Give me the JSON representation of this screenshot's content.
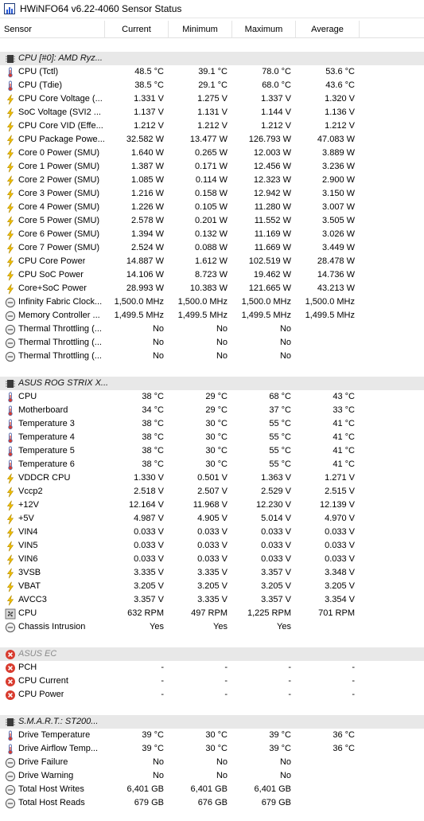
{
  "window": {
    "title": "HWiNFO64 v6.22-4060 Sensor Status"
  },
  "columns": [
    "Sensor",
    "Current",
    "Minimum",
    "Maximum",
    "Average"
  ],
  "colors": {
    "group_bg": "#e8e8e8",
    "accent_bolt": "#f5c400",
    "error_red": "#d83b2e"
  },
  "rows": [
    {
      "kind": "blank"
    },
    {
      "kind": "group",
      "icon": "chip-icon",
      "label": "CPU [#0]: AMD Ryz..."
    },
    {
      "kind": "sensor",
      "icon": "thermometer-icon",
      "label": "CPU (Tctl)",
      "cur": "48.5 °C",
      "min": "39.1 °C",
      "max": "78.0 °C",
      "avg": "53.6 °C"
    },
    {
      "kind": "sensor",
      "icon": "thermometer-icon",
      "label": "CPU (Tdie)",
      "cur": "38.5 °C",
      "min": "29.1 °C",
      "max": "68.0 °C",
      "avg": "43.6 °C"
    },
    {
      "kind": "sensor",
      "icon": "bolt-icon",
      "label": "CPU Core Voltage (...",
      "cur": "1.331 V",
      "min": "1.275 V",
      "max": "1.337 V",
      "avg": "1.320 V"
    },
    {
      "kind": "sensor",
      "icon": "bolt-icon",
      "label": "SoC Voltage (SVI2 ...",
      "cur": "1.137 V",
      "min": "1.131 V",
      "max": "1.144 V",
      "avg": "1.136 V"
    },
    {
      "kind": "sensor",
      "icon": "bolt-icon",
      "label": "CPU Core VID (Effe...",
      "cur": "1.212 V",
      "min": "1.212 V",
      "max": "1.212 V",
      "avg": "1.212 V"
    },
    {
      "kind": "sensor",
      "icon": "bolt-icon",
      "label": "CPU Package Powe...",
      "cur": "32.582 W",
      "min": "13.477 W",
      "max": "126.793 W",
      "avg": "47.083 W"
    },
    {
      "kind": "sensor",
      "icon": "bolt-icon",
      "label": "Core 0 Power (SMU)",
      "cur": "1.640 W",
      "min": "0.265 W",
      "max": "12.003 W",
      "avg": "3.889 W"
    },
    {
      "kind": "sensor",
      "icon": "bolt-icon",
      "label": "Core 1 Power (SMU)",
      "cur": "1.387 W",
      "min": "0.171 W",
      "max": "12.456 W",
      "avg": "3.236 W"
    },
    {
      "kind": "sensor",
      "icon": "bolt-icon",
      "label": "Core 2 Power (SMU)",
      "cur": "1.085 W",
      "min": "0.114 W",
      "max": "12.323 W",
      "avg": "2.900 W"
    },
    {
      "kind": "sensor",
      "icon": "bolt-icon",
      "label": "Core 3 Power (SMU)",
      "cur": "1.216 W",
      "min": "0.158 W",
      "max": "12.942 W",
      "avg": "3.150 W"
    },
    {
      "kind": "sensor",
      "icon": "bolt-icon",
      "label": "Core 4 Power (SMU)",
      "cur": "1.226 W",
      "min": "0.105 W",
      "max": "11.280 W",
      "avg": "3.007 W"
    },
    {
      "kind": "sensor",
      "icon": "bolt-icon",
      "label": "Core 5 Power (SMU)",
      "cur": "2.578 W",
      "min": "0.201 W",
      "max": "11.552 W",
      "avg": "3.505 W"
    },
    {
      "kind": "sensor",
      "icon": "bolt-icon",
      "label": "Core 6 Power (SMU)",
      "cur": "1.394 W",
      "min": "0.132 W",
      "max": "11.169 W",
      "avg": "3.026 W"
    },
    {
      "kind": "sensor",
      "icon": "bolt-icon",
      "label": "Core 7 Power (SMU)",
      "cur": "2.524 W",
      "min": "0.088 W",
      "max": "11.669 W",
      "avg": "3.449 W"
    },
    {
      "kind": "sensor",
      "icon": "bolt-icon",
      "label": "CPU Core Power",
      "cur": "14.887 W",
      "min": "1.612 W",
      "max": "102.519 W",
      "avg": "28.478 W"
    },
    {
      "kind": "sensor",
      "icon": "bolt-icon",
      "label": "CPU SoC Power",
      "cur": "14.106 W",
      "min": "8.723 W",
      "max": "19.462 W",
      "avg": "14.736 W"
    },
    {
      "kind": "sensor",
      "icon": "bolt-icon",
      "label": "Core+SoC Power",
      "cur": "28.993 W",
      "min": "10.383 W",
      "max": "121.665 W",
      "avg": "43.213 W"
    },
    {
      "kind": "sensor",
      "icon": "clock-icon",
      "label": "Infinity Fabric Clock...",
      "cur": "1,500.0 MHz",
      "min": "1,500.0 MHz",
      "max": "1,500.0 MHz",
      "avg": "1,500.0 MHz"
    },
    {
      "kind": "sensor",
      "icon": "clock-icon",
      "label": "Memory Controller ...",
      "cur": "1,499.5 MHz",
      "min": "1,499.5 MHz",
      "max": "1,499.5 MHz",
      "avg": "1,499.5 MHz"
    },
    {
      "kind": "sensor",
      "icon": "clock-icon",
      "label": "Thermal Throttling (...",
      "cur": "No",
      "min": "No",
      "max": "No",
      "avg": ""
    },
    {
      "kind": "sensor",
      "icon": "clock-icon",
      "label": "Thermal Throttling (...",
      "cur": "No",
      "min": "No",
      "max": "No",
      "avg": ""
    },
    {
      "kind": "sensor",
      "icon": "clock-icon",
      "label": "Thermal Throttling (...",
      "cur": "No",
      "min": "No",
      "max": "No",
      "avg": ""
    },
    {
      "kind": "blank"
    },
    {
      "kind": "group",
      "icon": "chip-icon",
      "label": "ASUS ROG STRIX X..."
    },
    {
      "kind": "sensor",
      "icon": "thermometer-icon",
      "label": "CPU",
      "cur": "38 °C",
      "min": "29 °C",
      "max": "68 °C",
      "avg": "43 °C"
    },
    {
      "kind": "sensor",
      "icon": "thermometer-icon",
      "label": "Motherboard",
      "cur": "34 °C",
      "min": "29 °C",
      "max": "37 °C",
      "avg": "33 °C"
    },
    {
      "kind": "sensor",
      "icon": "thermometer-icon",
      "label": "Temperature 3",
      "cur": "38 °C",
      "min": "30 °C",
      "max": "55 °C",
      "avg": "41 °C"
    },
    {
      "kind": "sensor",
      "icon": "thermometer-icon",
      "label": "Temperature 4",
      "cur": "38 °C",
      "min": "30 °C",
      "max": "55 °C",
      "avg": "41 °C"
    },
    {
      "kind": "sensor",
      "icon": "thermometer-icon",
      "label": "Temperature 5",
      "cur": "38 °C",
      "min": "30 °C",
      "max": "55 °C",
      "avg": "41 °C"
    },
    {
      "kind": "sensor",
      "icon": "thermometer-icon",
      "label": "Temperature 6",
      "cur": "38 °C",
      "min": "30 °C",
      "max": "55 °C",
      "avg": "41 °C"
    },
    {
      "kind": "sensor",
      "icon": "bolt-icon",
      "label": "VDDCR CPU",
      "cur": "1.330 V",
      "min": "0.501 V",
      "max": "1.363 V",
      "avg": "1.271 V"
    },
    {
      "kind": "sensor",
      "icon": "bolt-icon",
      "label": "Vccp2",
      "cur": "2.518 V",
      "min": "2.507 V",
      "max": "2.529 V",
      "avg": "2.515 V"
    },
    {
      "kind": "sensor",
      "icon": "bolt-icon",
      "label": "+12V",
      "cur": "12.164 V",
      "min": "11.968 V",
      "max": "12.230 V",
      "avg": "12.139 V"
    },
    {
      "kind": "sensor",
      "icon": "bolt-icon",
      "label": "+5V",
      "cur": "4.987 V",
      "min": "4.905 V",
      "max": "5.014 V",
      "avg": "4.970 V"
    },
    {
      "kind": "sensor",
      "icon": "bolt-icon",
      "label": "VIN4",
      "cur": "0.033 V",
      "min": "0.033 V",
      "max": "0.033 V",
      "avg": "0.033 V"
    },
    {
      "kind": "sensor",
      "icon": "bolt-icon",
      "label": "VIN5",
      "cur": "0.033 V",
      "min": "0.033 V",
      "max": "0.033 V",
      "avg": "0.033 V"
    },
    {
      "kind": "sensor",
      "icon": "bolt-icon",
      "label": "VIN6",
      "cur": "0.033 V",
      "min": "0.033 V",
      "max": "0.033 V",
      "avg": "0.033 V"
    },
    {
      "kind": "sensor",
      "icon": "bolt-icon",
      "label": "3VSB",
      "cur": "3.335 V",
      "min": "3.335 V",
      "max": "3.357 V",
      "avg": "3.348 V"
    },
    {
      "kind": "sensor",
      "icon": "bolt-icon",
      "label": "VBAT",
      "cur": "3.205 V",
      "min": "3.205 V",
      "max": "3.205 V",
      "avg": "3.205 V"
    },
    {
      "kind": "sensor",
      "icon": "bolt-icon",
      "label": "AVCC3",
      "cur": "3.357 V",
      "min": "3.335 V",
      "max": "3.357 V",
      "avg": "3.354 V"
    },
    {
      "kind": "sensor",
      "icon": "fan-icon",
      "label": "CPU",
      "cur": "632 RPM",
      "min": "497 RPM",
      "max": "1,225 RPM",
      "avg": "701 RPM"
    },
    {
      "kind": "sensor",
      "icon": "clock-icon",
      "label": "Chassis Intrusion",
      "cur": "Yes",
      "min": "Yes",
      "max": "Yes",
      "avg": ""
    },
    {
      "kind": "blank"
    },
    {
      "kind": "group",
      "icon": "error-icon",
      "label": "ASUS EC",
      "disabled": true
    },
    {
      "kind": "sensor",
      "icon": "error-icon",
      "label": "PCH",
      "cur": "-",
      "min": "-",
      "max": "-",
      "avg": "-"
    },
    {
      "kind": "sensor",
      "icon": "error-icon",
      "label": "CPU Current",
      "cur": "-",
      "min": "-",
      "max": "-",
      "avg": "-"
    },
    {
      "kind": "sensor",
      "icon": "error-icon",
      "label": "CPU Power",
      "cur": "-",
      "min": "-",
      "max": "-",
      "avg": "-"
    },
    {
      "kind": "blank"
    },
    {
      "kind": "group",
      "icon": "chip-icon",
      "label": "S.M.A.R.T.: ST200..."
    },
    {
      "kind": "sensor",
      "icon": "thermometer-icon",
      "label": "Drive Temperature",
      "cur": "39 °C",
      "min": "30 °C",
      "max": "39 °C",
      "avg": "36 °C"
    },
    {
      "kind": "sensor",
      "icon": "thermometer-icon",
      "label": "Drive Airflow Temp...",
      "cur": "39 °C",
      "min": "30 °C",
      "max": "39 °C",
      "avg": "36 °C"
    },
    {
      "kind": "sensor",
      "icon": "clock-icon",
      "label": "Drive Failure",
      "cur": "No",
      "min": "No",
      "max": "No",
      "avg": ""
    },
    {
      "kind": "sensor",
      "icon": "clock-icon",
      "label": "Drive Warning",
      "cur": "No",
      "min": "No",
      "max": "No",
      "avg": ""
    },
    {
      "kind": "sensor",
      "icon": "clock-icon",
      "label": "Total Host Writes",
      "cur": "6,401 GB",
      "min": "6,401 GB",
      "max": "6,401 GB",
      "avg": ""
    },
    {
      "kind": "sensor",
      "icon": "clock-icon",
      "label": "Total Host Reads",
      "cur": "679 GB",
      "min": "676 GB",
      "max": "679 GB",
      "avg": ""
    }
  ]
}
